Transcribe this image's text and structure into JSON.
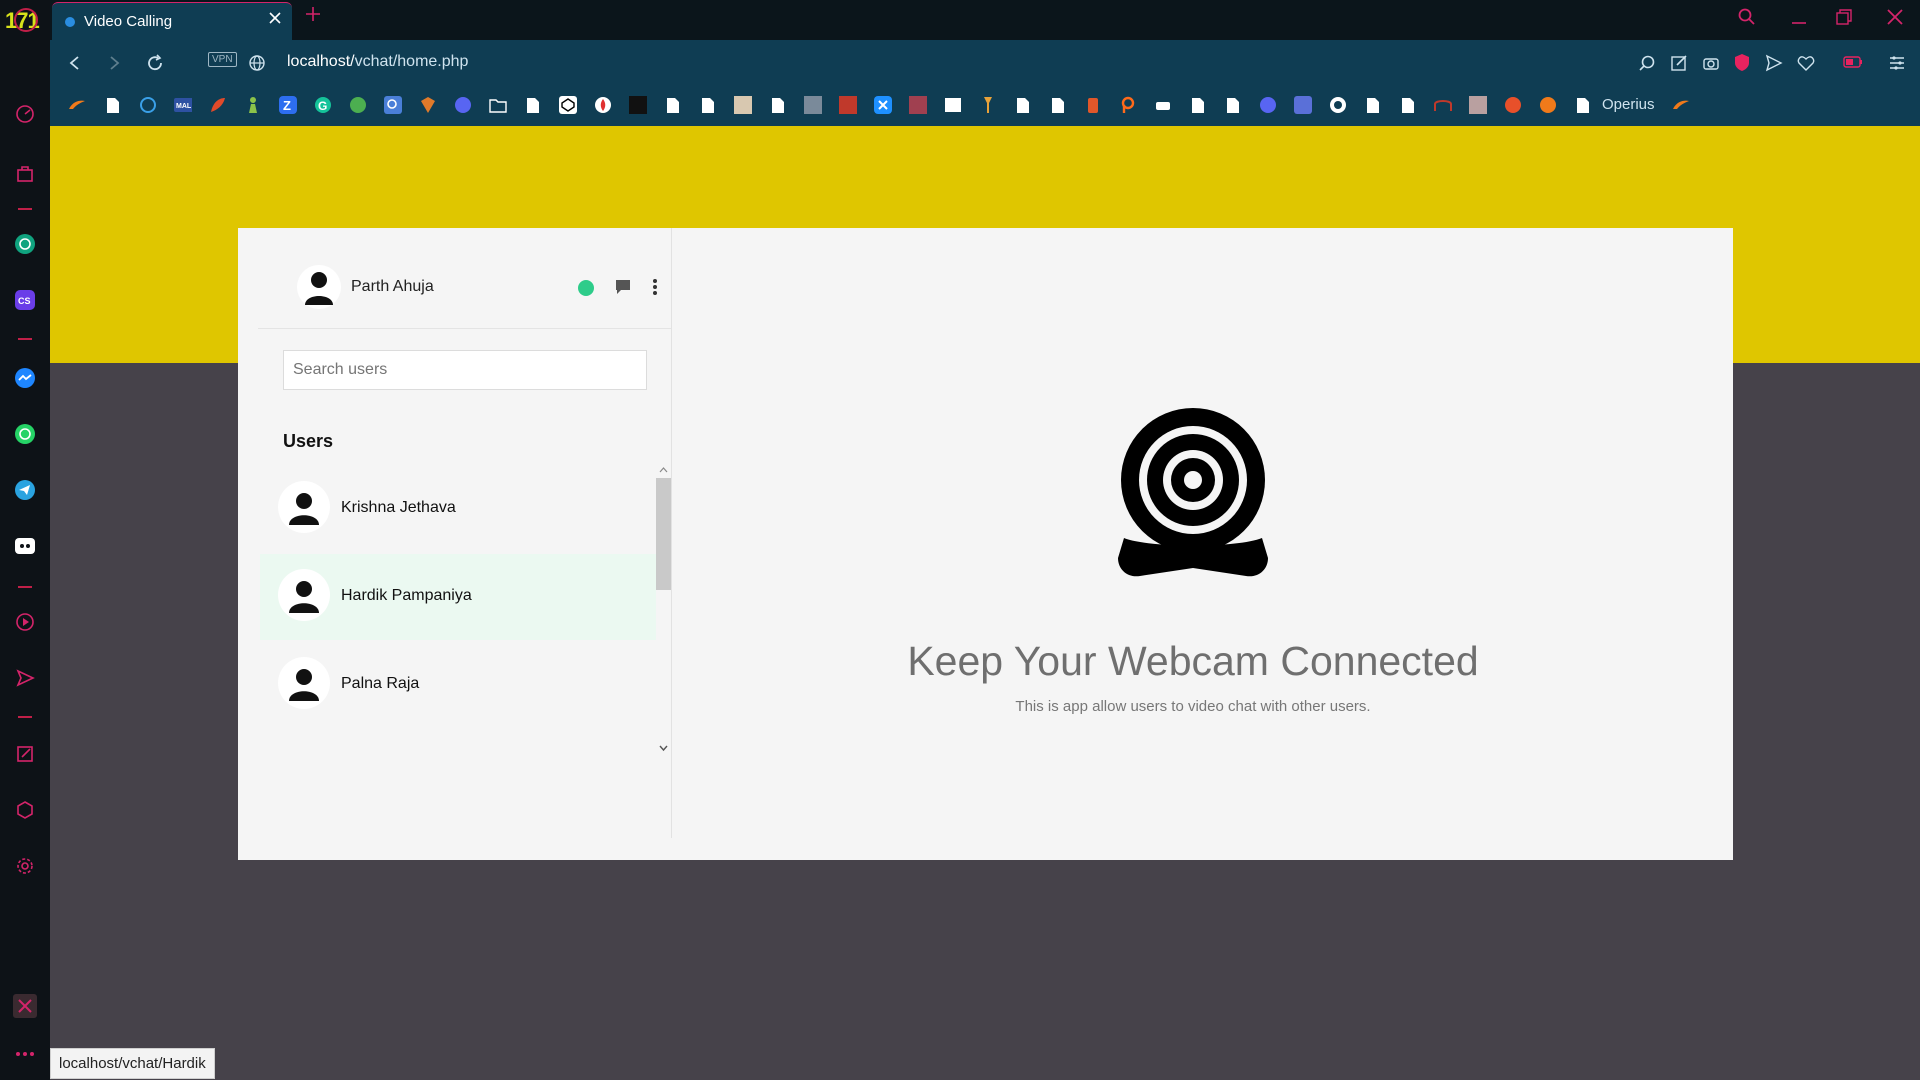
{
  "browser": {
    "tab_title": "Video Calling",
    "url_host": "localhost/",
    "url_path": "vchat/home.php",
    "vpn_label": "VPN",
    "bookmark_label": "Operius",
    "status_url": "localhost/vchat/Hardik",
    "accent": "#d4246a"
  },
  "app": {
    "me": {
      "name": "Parth Ahuja",
      "status_color": "#2ecc8a"
    },
    "search": {
      "placeholder": "Search users",
      "value": ""
    },
    "users_heading": "Users",
    "users": [
      {
        "name": "Krishna Jethava",
        "selected": false
      },
      {
        "name": "Hardik Pampaniya",
        "selected": true
      },
      {
        "name": "Palna Raja",
        "selected": false
      }
    ],
    "hero": {
      "title": "Keep Your Webcam Connected",
      "subtitle": "This is app allow users to video chat with other users.",
      "icon": "webcam-icon"
    },
    "colors": {
      "banner": "#dfc600",
      "backdrop": "#46424a"
    }
  }
}
